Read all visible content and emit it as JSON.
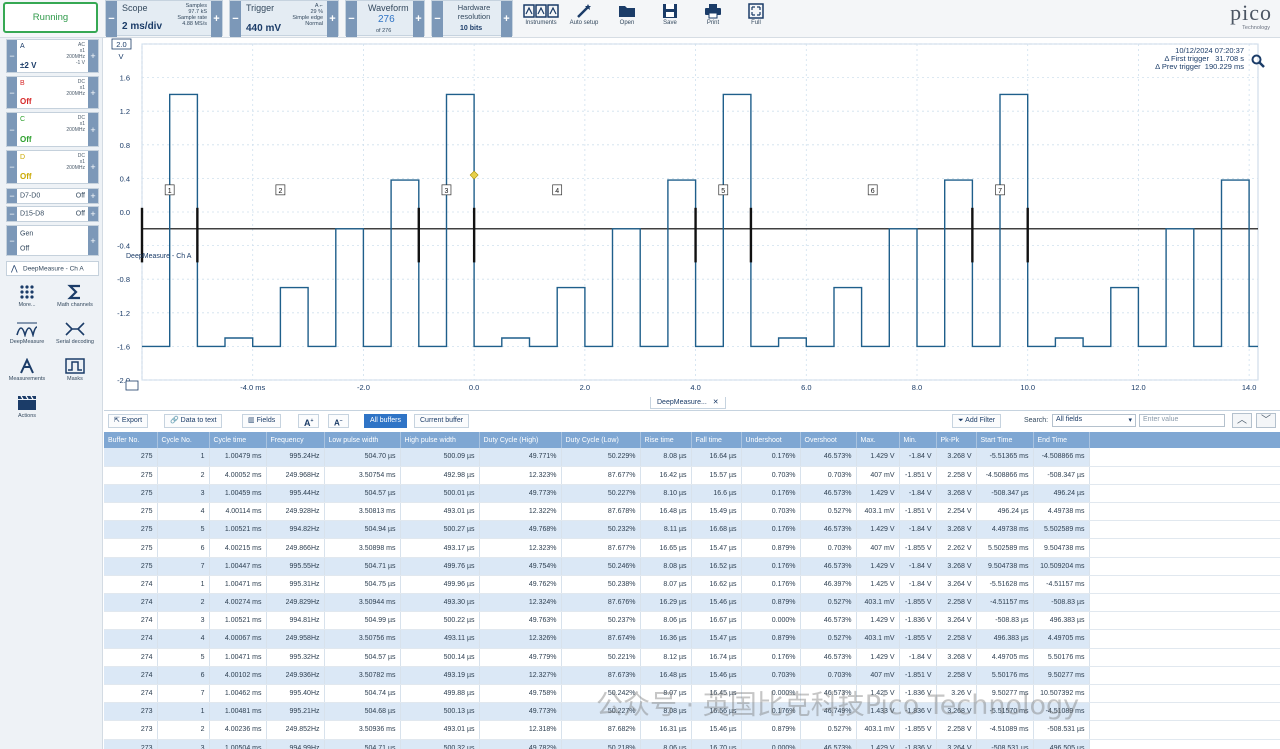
{
  "toolbar": {
    "running": "Running",
    "scope": {
      "label": "Scope",
      "value": "2 ms/div",
      "samples_label": "Samples",
      "samples_value": "97.7 kS",
      "rate_label": "Sample rate",
      "rate_value": "4.88 MS/s"
    },
    "trigger": {
      "label": "Trigger",
      "value": "440 mV",
      "channel": "A",
      "pre": "29 %",
      "mode1": "Simple edge",
      "mode2": "Normal"
    },
    "waveform": {
      "label": "Waveform",
      "value": "276",
      "of": "of 276"
    },
    "resolution": {
      "label": "Hardware resolution",
      "value": "10 bits"
    },
    "icons": [
      {
        "label": "Instruments",
        "icon": "instruments-icon"
      },
      {
        "label": "Auto setup",
        "icon": "wand-icon"
      },
      {
        "label": "Open",
        "icon": "folder-icon"
      },
      {
        "label": "Save",
        "icon": "save-icon"
      },
      {
        "label": "Print",
        "icon": "printer-icon"
      },
      {
        "label": "Full",
        "icon": "fullscreen-icon"
      }
    ],
    "logo": "pico",
    "logo_sub": "Technology"
  },
  "channels": [
    {
      "name": "A",
      "state": "±2 V",
      "desc": [
        "AC",
        "x1",
        "200MHz",
        "-1 V"
      ],
      "color": "#1b3c68"
    },
    {
      "name": "B",
      "state": "Off",
      "desc": [
        "DC",
        "x1",
        "200MHz"
      ],
      "color": "#d62728"
    },
    {
      "name": "C",
      "state": "Off",
      "desc": [
        "DC",
        "x1",
        "200MHz"
      ],
      "color": "#2ca02c"
    },
    {
      "name": "D",
      "state": "Off",
      "desc": [
        "DC",
        "x1",
        "200MHz"
      ],
      "color": "#c9a800"
    }
  ],
  "digital": [
    {
      "name": "D7-D0",
      "state": "Off"
    },
    {
      "name": "D15-D8",
      "state": "Off"
    }
  ],
  "gen": {
    "name": "Gen",
    "state": "Off"
  },
  "deepmeasure_label": "DeepMeasure - Ch A",
  "tools": [
    {
      "label": "More...",
      "icon": "grid-dots-icon"
    },
    {
      "label": "Math channels",
      "icon": "sigma-icon"
    },
    {
      "label": "DeepMeasure",
      "icon": "deepmeasure-icon"
    },
    {
      "label": "Serial decoding",
      "icon": "serial-decoding-icon"
    },
    {
      "label": "Measurements",
      "icon": "measurements-icon"
    },
    {
      "label": "Masks",
      "icon": "masks-icon"
    },
    {
      "label": "Actions",
      "icon": "actions-icon"
    }
  ],
  "scope_view": {
    "y_unit": "V",
    "y_box": "2.0",
    "y_ticks": [
      "1.6",
      "1.2",
      "0.8",
      "0.4",
      "0.0",
      "-0.4",
      "-0.8",
      "-1.2",
      "-1.6",
      "-2.0"
    ],
    "x_ticks": [
      "-4.0 ms",
      "-2.0",
      "0.0",
      "2.0",
      "4.0",
      "6.0",
      "8.0",
      "10.0",
      "12.0",
      "14.0"
    ],
    "cycle_labels": [
      "1",
      "2",
      "3",
      "4",
      "5",
      "6",
      "7"
    ],
    "overlay_label": "DeepMeasure - Ch A",
    "timestamp": "10/12/2024 07:20:37",
    "first_trigger_label": "Δ First trigger",
    "first_trigger": "31.708 s",
    "prev_trigger_label": "Δ Prev trigger",
    "prev_trigger": "190.229 ms",
    "trace_color": "#1f5f8b",
    "pattern_volts": [
      -1.6,
      1.4,
      -1.6,
      -1.5,
      -1.6,
      -0.9,
      -1.6,
      -0.2,
      -1.6,
      0.38
    ]
  },
  "deepmeasure_tab": "DeepMeasure...",
  "results_toolbar": {
    "export": "Export",
    "data_to_text": "Data to text",
    "fields": "Fields",
    "all_buffers": "All buffers",
    "current_buffer": "Current buffer",
    "add_filter": "Add Filter",
    "search_label": "Search:",
    "search_scope": "All fields",
    "search_placeholder": "Enter value"
  },
  "table": {
    "columns": [
      "Buffer No.",
      "Cycle No.",
      "Cycle time",
      "Frequency",
      "Low pulse width",
      "High pulse width",
      "Duty Cycle (High)",
      "Duty Cycle (Low)",
      "Rise time",
      "Fall time",
      "Undershoot",
      "Overshoot",
      "Max.",
      "Min.",
      "Pk-Pk",
      "Start Time",
      "End Time"
    ],
    "rows": [
      [
        "275",
        "1",
        "1.00479 ms",
        "995.24Hz",
        "504.70 µs",
        "500.09 µs",
        "49.771%",
        "50.229%",
        "8.08 µs",
        "16.64 µs",
        "0.176%",
        "46.573%",
        "1.429 V",
        "-1.84 V",
        "3.268 V",
        "-5.51365 ms",
        "-4.508866 ms"
      ],
      [
        "275",
        "2",
        "4.00052 ms",
        "249.968Hz",
        "3.50754 ms",
        "492.98 µs",
        "12.323%",
        "87.677%",
        "16.42 µs",
        "15.57 µs",
        "0.703%",
        "0.703%",
        "407 mV",
        "-1.851 V",
        "2.258 V",
        "-4.508866 ms",
        "-508.347 µs"
      ],
      [
        "275",
        "3",
        "1.00459 ms",
        "995.44Hz",
        "504.57 µs",
        "500.01 µs",
        "49.773%",
        "50.227%",
        "8.10 µs",
        "16.6 µs",
        "0.176%",
        "46.573%",
        "1.429 V",
        "-1.84 V",
        "3.268 V",
        "-508.347 µs",
        "496.24 µs"
      ],
      [
        "275",
        "4",
        "4.00114 ms",
        "249.928Hz",
        "3.50813 ms",
        "493.01 µs",
        "12.322%",
        "87.678%",
        "16.48 µs",
        "15.49 µs",
        "0.703%",
        "0.527%",
        "403.1 mV",
        "-1.851 V",
        "2.254 V",
        "496.24 µs",
        "4.49738 ms"
      ],
      [
        "275",
        "5",
        "1.00521 ms",
        "994.82Hz",
        "504.94 µs",
        "500.27 µs",
        "49.768%",
        "50.232%",
        "8.11 µs",
        "16.68 µs",
        "0.176%",
        "46.573%",
        "1.429 V",
        "-1.84 V",
        "3.268 V",
        "4.49738 ms",
        "5.502589 ms"
      ],
      [
        "275",
        "6",
        "4.00215 ms",
        "249.866Hz",
        "3.50898 ms",
        "493.17 µs",
        "12.323%",
        "87.677%",
        "16.65 µs",
        "15.47 µs",
        "0.879%",
        "0.703%",
        "407 mV",
        "-1.855 V",
        "2.262 V",
        "5.502589 ms",
        "9.504738 ms"
      ],
      [
        "275",
        "7",
        "1.00447 ms",
        "995.55Hz",
        "504.71 µs",
        "499.76 µs",
        "49.754%",
        "50.246%",
        "8.08 µs",
        "16.52 µs",
        "0.176%",
        "46.573%",
        "1.429 V",
        "-1.84 V",
        "3.268 V",
        "9.504738 ms",
        "10.509204 ms"
      ],
      [
        "274",
        "1",
        "1.00471 ms",
        "995.31Hz",
        "504.75 µs",
        "499.96 µs",
        "49.762%",
        "50.238%",
        "8.07 µs",
        "16.62 µs",
        "0.176%",
        "46.397%",
        "1.425 V",
        "-1.84 V",
        "3.264 V",
        "-5.51628 ms",
        "-4.51157 ms"
      ],
      [
        "274",
        "2",
        "4.00274 ms",
        "249.829Hz",
        "3.50944 ms",
        "493.30 µs",
        "12.324%",
        "87.676%",
        "16.29 µs",
        "15.46 µs",
        "0.879%",
        "0.527%",
        "403.1 mV",
        "-1.855 V",
        "2.258 V",
        "-4.51157 ms",
        "-508.83 µs"
      ],
      [
        "274",
        "3",
        "1.00521 ms",
        "994.81Hz",
        "504.99 µs",
        "500.22 µs",
        "49.763%",
        "50.237%",
        "8.06 µs",
        "16.67 µs",
        "0.000%",
        "46.573%",
        "1.429 V",
        "-1.836 V",
        "3.264 V",
        "-508.83 µs",
        "496.383 µs"
      ],
      [
        "274",
        "4",
        "4.00067 ms",
        "249.958Hz",
        "3.50756 ms",
        "493.11 µs",
        "12.326%",
        "87.674%",
        "16.36 µs",
        "15.47 µs",
        "0.879%",
        "0.527%",
        "403.1 mV",
        "-1.855 V",
        "2.258 V",
        "496.383 µs",
        "4.49705 ms"
      ],
      [
        "274",
        "5",
        "1.00471 ms",
        "995.32Hz",
        "504.57 µs",
        "500.14 µs",
        "49.779%",
        "50.221%",
        "8.12 µs",
        "16.74 µs",
        "0.176%",
        "46.573%",
        "1.429 V",
        "-1.84 V",
        "3.268 V",
        "4.49705 ms",
        "5.50176 ms"
      ],
      [
        "274",
        "6",
        "4.00102 ms",
        "249.936Hz",
        "3.50782 ms",
        "493.19 µs",
        "12.327%",
        "87.673%",
        "16.48 µs",
        "15.46 µs",
        "0.703%",
        "0.703%",
        "407 mV",
        "-1.851 V",
        "2.258 V",
        "5.50176 ms",
        "9.50277 ms"
      ],
      [
        "274",
        "7",
        "1.00462 ms",
        "995.40Hz",
        "504.74 µs",
        "499.88 µs",
        "49.758%",
        "50.242%",
        "8.07 µs",
        "16.45 µs",
        "0.000%",
        "46.573%",
        "1.425 V",
        "-1.836 V",
        "3.26 V",
        "9.50277 ms",
        "10.507392 ms"
      ],
      [
        "273",
        "1",
        "1.00481 ms",
        "995.21Hz",
        "504.68 µs",
        "500.13 µs",
        "49.773%",
        "50.227%",
        "8.08 µs",
        "16.56 µs",
        "0.176%",
        "46.749%",
        "1.433 V",
        "-1.836 V",
        "3.268 V",
        "-5.51570 ms",
        "-4.51089 ms"
      ],
      [
        "273",
        "2",
        "4.00236 ms",
        "249.852Hz",
        "3.50936 ms",
        "493.01 µs",
        "12.318%",
        "87.682%",
        "16.31 µs",
        "15.46 µs",
        "0.879%",
        "0.527%",
        "403.1 mV",
        "-1.855 V",
        "2.258 V",
        "-4.51089 ms",
        "-508.531 µs"
      ],
      [
        "273",
        "3",
        "1.00504 ms",
        "994.99Hz",
        "504.71 µs",
        "500.32 µs",
        "49.782%",
        "50.218%",
        "8.06 µs",
        "16.70 µs",
        "0.000%",
        "46.573%",
        "1.429 V",
        "-1.836 V",
        "3.264 V",
        "-508.531 µs",
        "496.505 µs"
      ]
    ]
  },
  "watermark": "公众号 · 英国比克科技Pico Technology"
}
